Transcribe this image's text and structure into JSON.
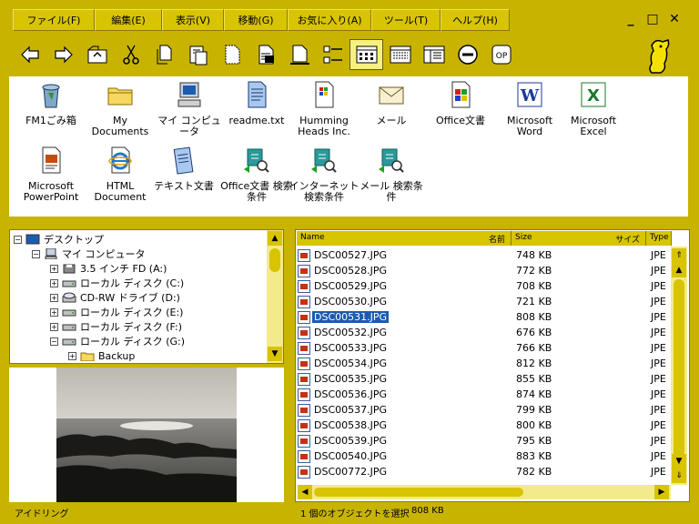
{
  "menu": [
    {
      "label": "ファイル(F)",
      "w": 0
    },
    {
      "label": "編集(E)"
    },
    {
      "label": "表示(V)"
    },
    {
      "label": "移動(G)"
    },
    {
      "label": "お気に入り(A)"
    },
    {
      "label": "ツール(T)"
    },
    {
      "label": "ヘルプ(H)"
    }
  ],
  "window_controls": {
    "minimize": "_",
    "maximize": "□",
    "close": "✕"
  },
  "toolbar_icons": [
    "back-arrow-icon",
    "forward-arrow-icon",
    "up-folder-icon",
    "cut-icon",
    "copy-icon",
    "paste-icon",
    "new-file-icon",
    "properties-icon",
    "blank-page-icon",
    "list-view-icon",
    "large-icons-view-icon",
    "details-view-icon",
    "small-icons-view-icon",
    "stop-icon",
    "op-icon"
  ],
  "toolbar_op_label": "OP",
  "desktop_icons": [
    {
      "label": "FM1ごみ箱",
      "icon": "recycle-bin-icon"
    },
    {
      "label": "My Documents",
      "icon": "folder-icon"
    },
    {
      "label": "マイ コンピュータ",
      "icon": "computer-icon"
    },
    {
      "label": "readme.txt",
      "icon": "text-file-icon"
    },
    {
      "label": "Humming Heads Inc.",
      "icon": "document-icon"
    },
    {
      "label": "メール",
      "icon": "mail-icon"
    },
    {
      "label": "Office文書",
      "icon": "office-icon"
    },
    {
      "label": "Microsoft Word",
      "icon": "word-icon"
    },
    {
      "label": "Microsoft Excel",
      "icon": "excel-icon"
    },
    {
      "label": "Microsoft PowerPoint",
      "icon": "powerpoint-icon"
    },
    {
      "label": "HTML Document",
      "icon": "ie-icon"
    },
    {
      "label": "テキスト文書",
      "icon": "notepad-icon"
    },
    {
      "label": "Office文書 検索条件",
      "icon": "search-condition-icon"
    },
    {
      "label": "インターネット 検索条件",
      "icon": "search-condition-icon"
    },
    {
      "label": "メール 検索条件",
      "icon": "search-condition-icon"
    }
  ],
  "tree": [
    {
      "label": "デスクトップ",
      "level": 0,
      "pm": "−",
      "icon": "desktop-icon"
    },
    {
      "label": "マイ コンピュータ",
      "level": 1,
      "pm": "−",
      "icon": "computer-icon"
    },
    {
      "label": "3.5 インチ FD (A:)",
      "level": 2,
      "pm": "+",
      "icon": "floppy-icon"
    },
    {
      "label": "ローカル ディスク (C:)",
      "level": 2,
      "pm": "+",
      "icon": "disk-icon"
    },
    {
      "label": "CD-RW ドライブ (D:)",
      "level": 2,
      "pm": "+",
      "icon": "cd-icon"
    },
    {
      "label": "ローカル ディスク (E:)",
      "level": 2,
      "pm": "+",
      "icon": "disk-icon"
    },
    {
      "label": "ローカル ディスク (F:)",
      "level": 2,
      "pm": "+",
      "icon": "disk-icon"
    },
    {
      "label": "ローカル ディスク (G:)",
      "level": 2,
      "pm": "−",
      "icon": "disk-icon"
    },
    {
      "label": "Backup",
      "level": 3,
      "pm": "+",
      "icon": "folder-icon"
    }
  ],
  "list_headers": {
    "name": "Name",
    "name_jp": "名前",
    "size": "Size",
    "size_jp": "サイズ",
    "type": "Type"
  },
  "files": [
    {
      "name": "DSC00527.JPG",
      "size": "748 KB",
      "type": "JPE"
    },
    {
      "name": "DSC00528.JPG",
      "size": "772 KB",
      "type": "JPE"
    },
    {
      "name": "DSC00529.JPG",
      "size": "708 KB",
      "type": "JPE"
    },
    {
      "name": "DSC00530.JPG",
      "size": "721 KB",
      "type": "JPE"
    },
    {
      "name": "DSC00531.JPG",
      "size": "808 KB",
      "type": "JPE",
      "selected": true
    },
    {
      "name": "DSC00532.JPG",
      "size": "676 KB",
      "type": "JPE"
    },
    {
      "name": "DSC00533.JPG",
      "size": "766 KB",
      "type": "JPE"
    },
    {
      "name": "DSC00534.JPG",
      "size": "812 KB",
      "type": "JPE"
    },
    {
      "name": "DSC00535.JPG",
      "size": "855 KB",
      "type": "JPE"
    },
    {
      "name": "DSC00536.JPG",
      "size": "874 KB",
      "type": "JPE"
    },
    {
      "name": "DSC00537.JPG",
      "size": "799 KB",
      "type": "JPE"
    },
    {
      "name": "DSC00538.JPG",
      "size": "800 KB",
      "type": "JPE"
    },
    {
      "name": "DSC00539.JPG",
      "size": "795 KB",
      "type": "JPE"
    },
    {
      "name": "DSC00540.JPG",
      "size": "883 KB",
      "type": "JPE"
    },
    {
      "name": "DSC00772.JPG",
      "size": "782 KB",
      "type": "JPE"
    }
  ],
  "status": {
    "left": "アイドリング",
    "selection": "1 個のオブジェクトを選択",
    "size": "808 KB"
  },
  "colors": {
    "frame": "#c8b400",
    "selection": "#1c5bb0"
  }
}
